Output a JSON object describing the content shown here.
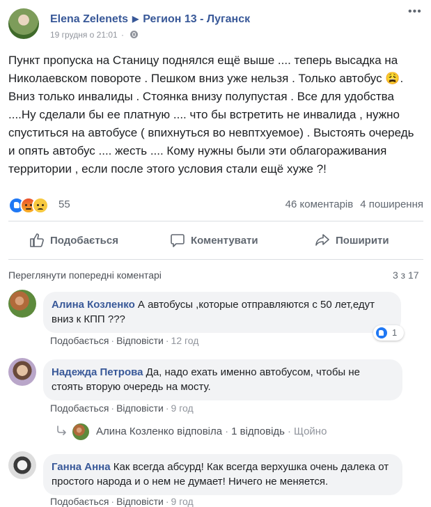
{
  "post": {
    "author": "Elena Zelenets",
    "group": "Регион 13 - Луганск",
    "date": "19 грудня о 21:01",
    "text": "Пункт пропуска на Станицу поднялся ещё выше .... теперь высадка на Николаевском повороте . Пешком вниз уже нельзя . Только автобус 😩. Вниз только инвалиды . Стоянка внизу полупустая . Все для удобства ....Ну сделали бы ее платную .... что бы встретить не инвалида , нужно спуститься на автобусе ( впихнуться во невптхуемое) . Выстоять очередь и опять автобус .... жесть .... Кому нужны были эти облагораживания территории , если после этого условия стали ещё хуже ?!",
    "reaction_count": "55",
    "comments_count": "46 коментарів",
    "shares_count": "4 поширення"
  },
  "actions": {
    "like": "Подобається",
    "comment": "Коментувати",
    "share": "Поширити"
  },
  "comments_section": {
    "view_previous": "Переглянути попередні коментарі",
    "count": "3 з 17",
    "like_label": "Подобається",
    "reply_label": "Відповісти",
    "items": [
      {
        "name": "Алина Козленко",
        "text": "А автобусы ,которые отправляются с 50 лет,едут вниз к КПП ???",
        "time": "12 год",
        "reactions": "1"
      },
      {
        "name": "Надежда Петрова",
        "text": "Да, надо ехать именно автобусом, чтобы не стоять вторую очередь на мосту.",
        "time": "9 год"
      },
      {
        "name": "Ганна Анна",
        "text": "Как всегда абсурд! Как всегда верхушка очень далека от простого народа и о нем не думает! Ничего не меняется.",
        "time": "9 год"
      }
    ],
    "reply_summary": {
      "text": "Алина Козленко відповіла",
      "count": "1 відповідь",
      "time": "Щойно"
    }
  },
  "icons": [
    "globe-icon",
    "more-icon",
    "like-icon",
    "angry-icon",
    "sad-icon",
    "comment-icon",
    "share-icon",
    "reply-arrow-icon"
  ]
}
